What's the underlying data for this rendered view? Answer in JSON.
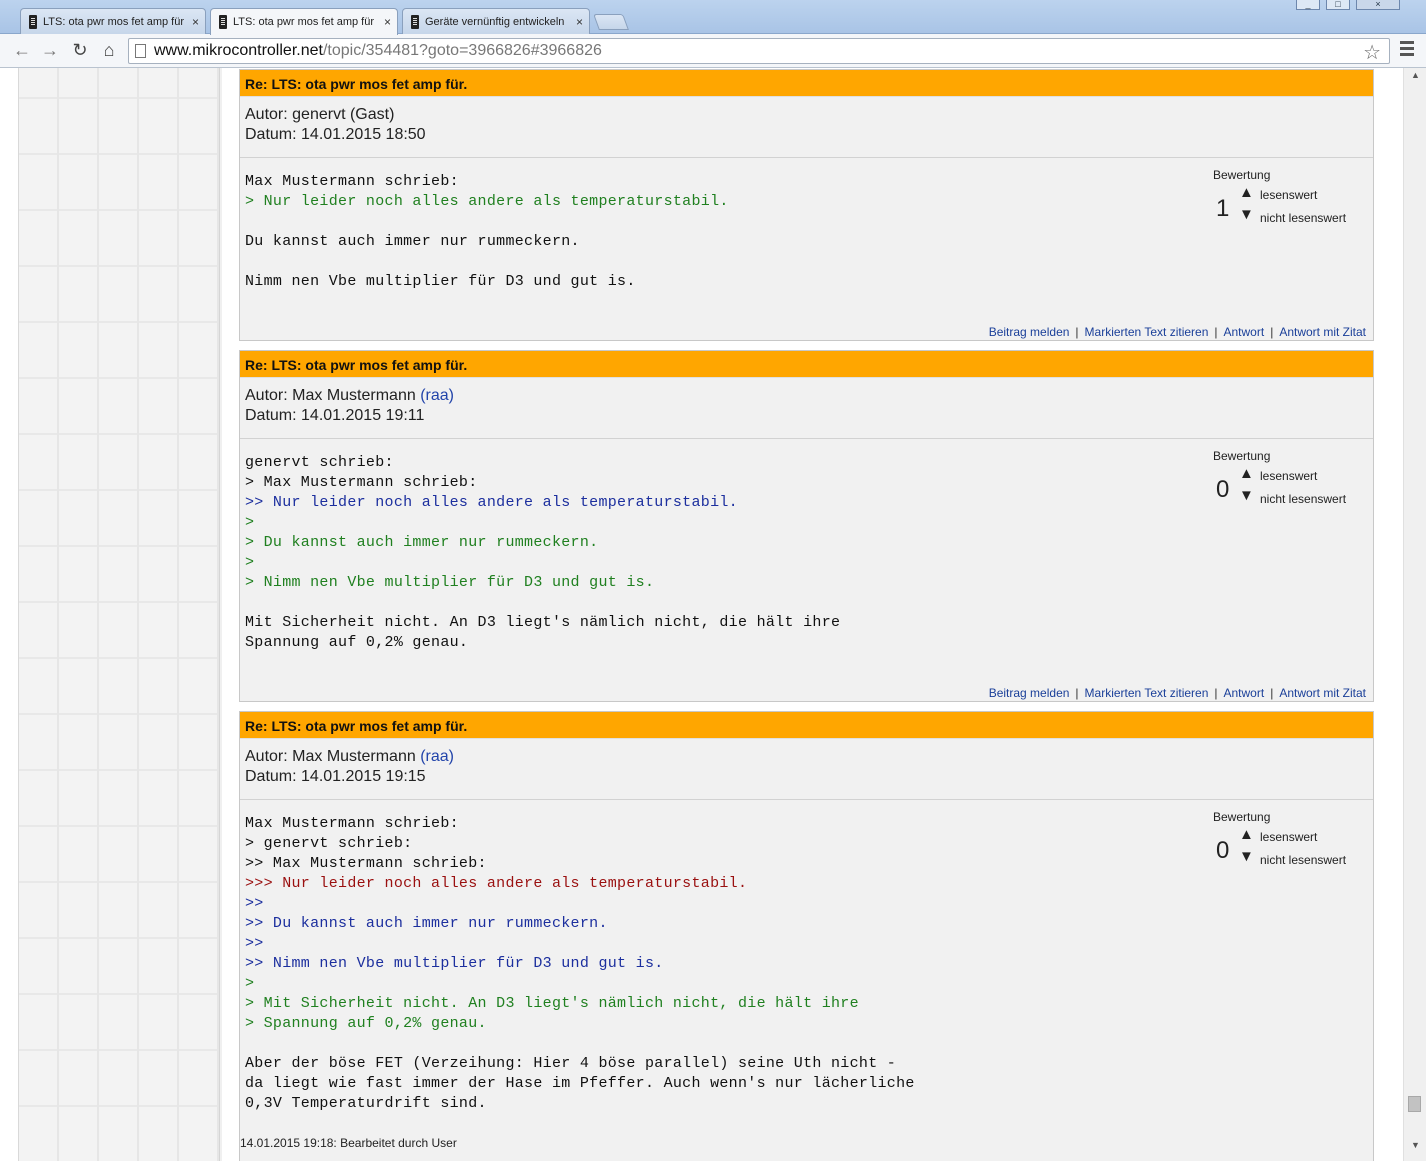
{
  "tabs": [
    {
      "title": "LTS: ota pwr mos fet amp für",
      "close": "×"
    },
    {
      "title": "LTS: ota pwr mos fet amp für",
      "close": "×"
    },
    {
      "title": "Geräte vernünftig entwickeln",
      "close": "×"
    }
  ],
  "toolbar": {
    "back": "←",
    "forward": "→",
    "reload": "↻",
    "home": "⌂",
    "url_host": "www.mikrocontroller.net",
    "url_path": "/topic/354481?goto=3966826#3966826",
    "star": "☆"
  },
  "window_controls": {
    "minimize": "_",
    "maximize": "□",
    "close": "×"
  },
  "labels": {
    "rating_title": "Bewertung",
    "readable": "lesenswert",
    "not_readable": "nicht lesenswert",
    "up_arrow": "▲",
    "down_arrow": "▼",
    "report": "Beitrag melden",
    "quote_marked": "Markierten Text zitieren",
    "reply": "Antwort",
    "reply_quote": "Antwort mit Zitat",
    "sep": "|"
  },
  "posts": [
    {
      "subject": "Re: LTS: ota pwr mos fet amp für.",
      "author_prefix": "Autor: ",
      "author": "genervt (Gast)",
      "nick": "",
      "date": "Datum: 14.01.2015 18:50",
      "rating": "1",
      "lines": [
        {
          "text": "Max Mustermann schrieb:",
          "level": "plain"
        },
        {
          "text": "> Nur leider noch alles andere als temperaturstabil.",
          "level": "q1"
        },
        {
          "text": "",
          "level": "plain"
        },
        {
          "text": "Du kannst auch immer nur rummeckern.",
          "level": "plain"
        },
        {
          "text": "",
          "level": "plain"
        },
        {
          "text": "Nimm nen Vbe multiplier für D3 und gut is.",
          "level": "plain"
        }
      ]
    },
    {
      "subject": "Re: LTS: ota pwr mos fet amp für.",
      "author_prefix": "Autor: ",
      "author": "Max Mustermann ",
      "nick": "(raa)",
      "date": "Datum: 14.01.2015 19:11",
      "rating": "0",
      "lines": [
        {
          "text": "genervt schrieb:",
          "level": "plain"
        },
        {
          "text": "> Max Mustermann schrieb:",
          "level": "plain"
        },
        {
          "text": ">> Nur leider noch alles andere als temperaturstabil.",
          "level": "q2"
        },
        {
          "text": ">",
          "level": "q1"
        },
        {
          "text": "> Du kannst auch immer nur rummeckern.",
          "level": "q1"
        },
        {
          "text": ">",
          "level": "q1"
        },
        {
          "text": "> Nimm nen Vbe multiplier für D3 und gut is.",
          "level": "q1"
        },
        {
          "text": "",
          "level": "plain"
        },
        {
          "text": "Mit Sicherheit nicht. An D3 liegt's nämlich nicht, die hält ihre",
          "level": "plain"
        },
        {
          "text": "Spannung auf 0,2% genau.",
          "level": "plain"
        }
      ]
    },
    {
      "subject": "Re: LTS: ota pwr mos fet amp für.",
      "author_prefix": "Autor: ",
      "author": "Max Mustermann ",
      "nick": "(raa)",
      "date": "Datum: 14.01.2015 19:15",
      "rating": "0",
      "lines": [
        {
          "text": "Max Mustermann schrieb:",
          "level": "plain"
        },
        {
          "text": "> genervt schrieb:",
          "level": "plain"
        },
        {
          "text": ">> Max Mustermann schrieb:",
          "level": "plain"
        },
        {
          "text": ">>> Nur leider noch alles andere als temperaturstabil.",
          "level": "q3"
        },
        {
          "text": ">>",
          "level": "q2"
        },
        {
          "text": ">> Du kannst auch immer nur rummeckern.",
          "level": "q2"
        },
        {
          "text": ">>",
          "level": "q2"
        },
        {
          "text": ">> Nimm nen Vbe multiplier für D3 und gut is.",
          "level": "q2"
        },
        {
          "text": ">",
          "level": "q1"
        },
        {
          "text": "> Mit Sicherheit nicht. An D3 liegt's nämlich nicht, die hält ihre",
          "level": "q1"
        },
        {
          "text": "> Spannung auf 0,2% genau.",
          "level": "q1"
        },
        {
          "text": "",
          "level": "plain"
        },
        {
          "text": "Aber der böse FET (Verzeihung: Hier 4 böse parallel) seine Uth nicht -",
          "level": "plain"
        },
        {
          "text": "da liegt wie fast immer der Hase im Pfeffer. Auch wenn's nur lächerliche",
          "level": "plain"
        },
        {
          "text": "0,3V Temperaturdrift sind.",
          "level": "plain"
        }
      ]
    }
  ],
  "edited_note": "14.01.2015 19:18: Bearbeitet durch User",
  "scrollbar": {
    "up": "▲",
    "down": "▼"
  }
}
